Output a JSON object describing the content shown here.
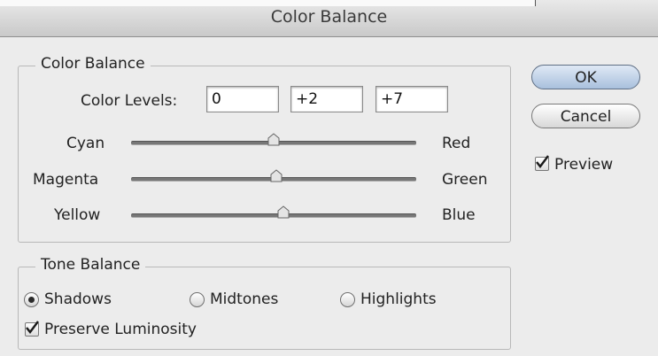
{
  "window": {
    "title": "Color Balance"
  },
  "color_balance": {
    "group_label": "Color Balance",
    "levels_label": "Color Levels:",
    "levels": [
      "0",
      "+2",
      "+7"
    ],
    "sliders": [
      {
        "left": "Cyan",
        "right": "Red",
        "value": 0
      },
      {
        "left": "Magenta",
        "right": "Green",
        "value": 2
      },
      {
        "left": "Yellow",
        "right": "Blue",
        "value": 7
      }
    ],
    "slider_range": [
      -100,
      100
    ]
  },
  "tone_balance": {
    "group_label": "Tone Balance",
    "options": [
      "Shadows",
      "Midtones",
      "Highlights"
    ],
    "selected": "Shadows",
    "preserve_label": "Preserve Luminosity",
    "preserve_checked": true
  },
  "buttons": {
    "ok": "OK",
    "cancel": "Cancel"
  },
  "preview": {
    "label": "Preview",
    "checked": true
  }
}
